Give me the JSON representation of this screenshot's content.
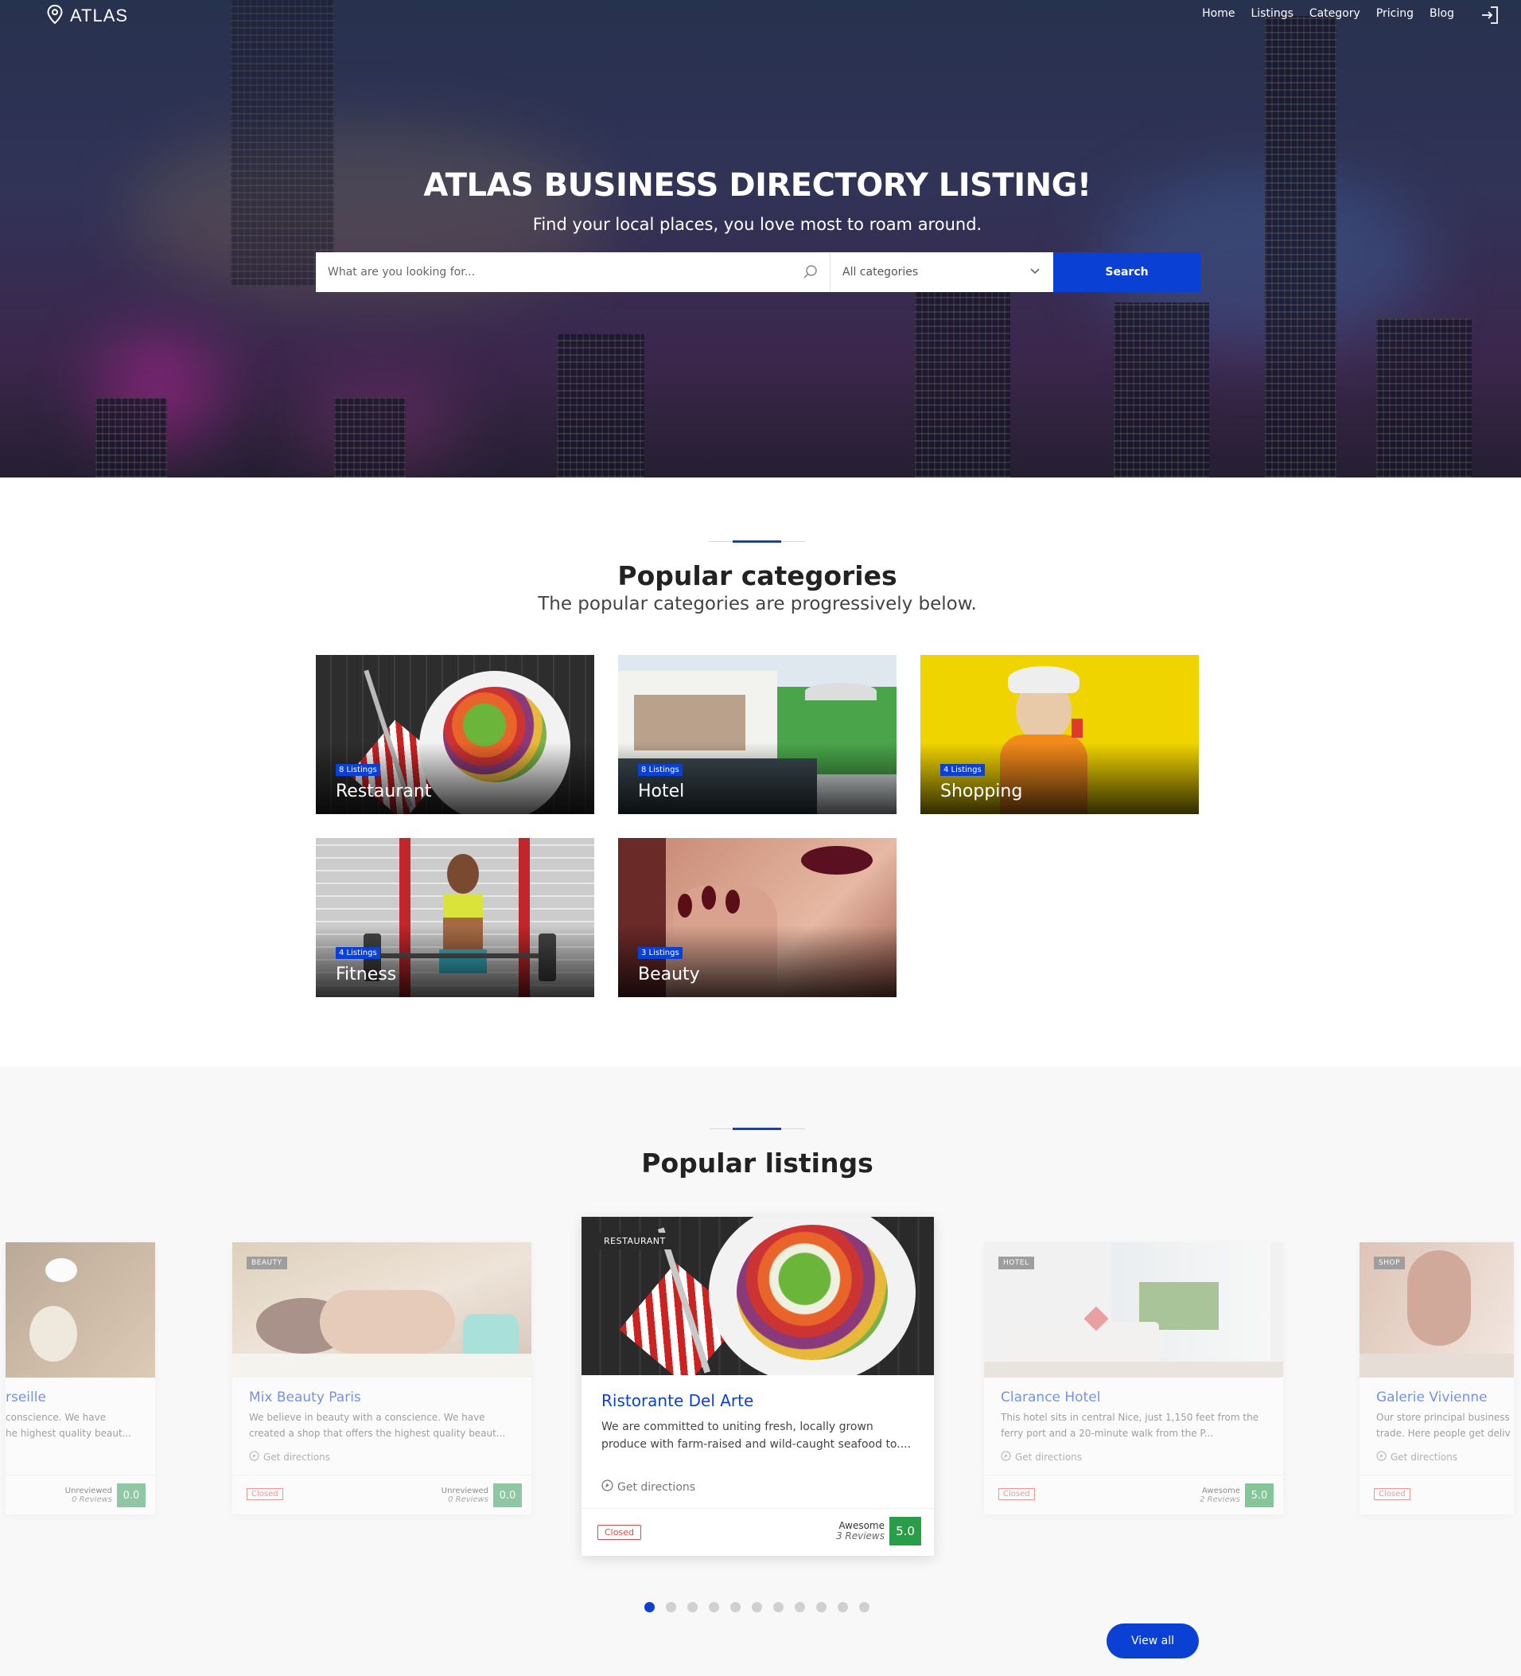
{
  "brand": {
    "name": "ATLAS"
  },
  "nav": {
    "items": [
      "Home",
      "Listings",
      "Category",
      "Pricing",
      "Blog"
    ]
  },
  "hero": {
    "title": "ATLAS BUSINESS DIRECTORY LISTING!",
    "subtitle": "Find your local places, you love most to roam around.",
    "search_placeholder": "What are you looking for...",
    "category_value": "All categories",
    "search_label": "Search"
  },
  "categories": {
    "title": "Popular categories",
    "subtitle": "The popular categories are progressively below.",
    "items": [
      {
        "name": "Restaurant",
        "count": "8 Listings"
      },
      {
        "name": "Hotel",
        "count": "8 Listings"
      },
      {
        "name": "Shopping",
        "count": "4 Listings"
      },
      {
        "name": "Fitness",
        "count": "4 Listings"
      },
      {
        "name": "Beauty",
        "count": "3 Listings"
      }
    ]
  },
  "listings": {
    "title": "Popular listings",
    "view_all": "View all",
    "carousel": {
      "total_slides": 11,
      "active_index": 0
    },
    "cards": [
      {
        "title": "rseille",
        "desc": "conscience. We have\nhe highest quality beaut...",
        "rating_label": "Unreviewed",
        "reviews": "0 Reviews",
        "score": "0.0"
      },
      {
        "type": "BEAUTY",
        "title": "Mix Beauty Paris",
        "desc": "We believe in beauty with a conscience. We have created a shop that offers the highest quality beaut...",
        "directions": "Get directions",
        "status": "Closed",
        "rating_label": "Unreviewed",
        "reviews": "0 Reviews",
        "score": "0.0"
      },
      {
        "type": "RESTAURANT",
        "title": "Ristorante Del Arte",
        "desc": "We are committed to uniting fresh, locally grown produce with farm-raised and wild-caught seafood to....",
        "directions": "Get directions",
        "status": "Closed",
        "rating_label": "Awesome",
        "reviews": "3 Reviews",
        "score": "5.0"
      },
      {
        "type": "HOTEL",
        "title": "Clarance Hotel",
        "desc": "This hotel sits in central Nice, just 1,150 feet from the ferry port and a 20-minute walk from the P...",
        "directions": "Get directions",
        "status": "Closed",
        "rating_label": "Awesome",
        "reviews": "2 Reviews",
        "score": "5.0"
      },
      {
        "type": "SHOP",
        "title": "Galerie Vivienne",
        "desc": "Our store principal business\ntrade. Here people get deliv",
        "directions": "Get directions",
        "status": "Closed"
      }
    ]
  },
  "icons": {
    "logo": "map-pin-icon",
    "signin": "sign-in-icon",
    "search": "search-icon",
    "dropdown": "chevron-down-icon",
    "directions": "compass-icon"
  },
  "colors": {
    "accent": "#0a40d4",
    "score": "#2a9d48",
    "closed": "#e44444"
  }
}
